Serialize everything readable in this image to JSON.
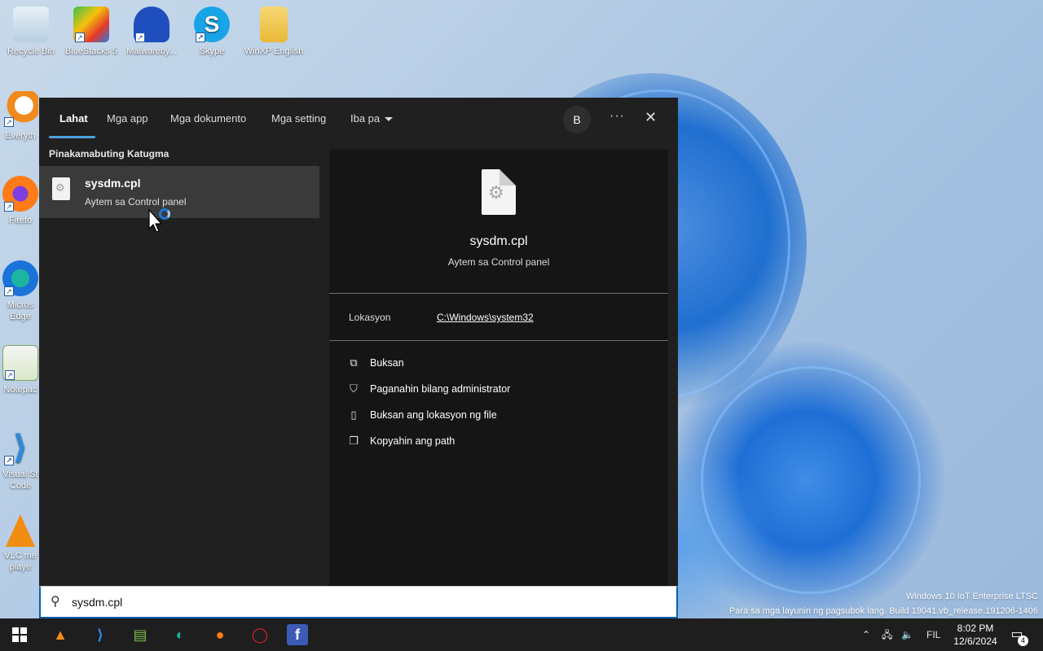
{
  "desktop": {
    "icons": [
      {
        "label": "Recycle Bin"
      },
      {
        "label": "BlueStacks 5"
      },
      {
        "label": "Malwareby..."
      },
      {
        "label": "Skype"
      },
      {
        "label": "WinXP English"
      },
      {
        "label": "Everyth"
      },
      {
        "label": "Firefo"
      },
      {
        "label": "Micros Edge"
      },
      {
        "label": "Notepac"
      },
      {
        "label": "Visual St Code"
      },
      {
        "label": "VLC me playe"
      }
    ]
  },
  "search": {
    "tabs": [
      {
        "label": "Lahat"
      },
      {
        "label": "Mga app"
      },
      {
        "label": "Mga dokumento"
      },
      {
        "label": "Mga setting"
      },
      {
        "label": "Iba pa"
      }
    ],
    "avatar_initial": "B",
    "more_glyph": "···",
    "close_glyph": "✕",
    "best_match_heading": "Pinakamabuting Katugma",
    "best_match": {
      "name": "sysdm.cpl",
      "type": "Aytem sa Control panel"
    },
    "detail": {
      "name": "sysdm.cpl",
      "type": "Aytem sa Control panel",
      "location_label": "Lokasyon",
      "location_value": "C:\\Windows\\system32",
      "actions": [
        {
          "label": "Buksan",
          "icon": "open-icon"
        },
        {
          "label": "Paganahin bilang administrator",
          "icon": "shield-icon"
        },
        {
          "label": "Buksan ang lokasyon ng file",
          "icon": "folder-icon"
        },
        {
          "label": "Kopyahin ang path",
          "icon": "copy-icon"
        }
      ]
    },
    "query": "sysdm.cpl"
  },
  "watermark": {
    "line1": "Windows 10 IoT Enterprise LTSC",
    "line2": "Para sa mga layunin ng pagsubok lang. Build 19041.vb_release.191206-1406"
  },
  "taskbar": {
    "language": "FIL",
    "time": "8:02 PM",
    "date": "12/6/2024",
    "notification_count": "4"
  },
  "colors": {
    "accent": "#4ca0e0",
    "panel_bg": "#202020",
    "detail_bg": "#151515",
    "taskbar_bg": "#1e1e1e"
  }
}
